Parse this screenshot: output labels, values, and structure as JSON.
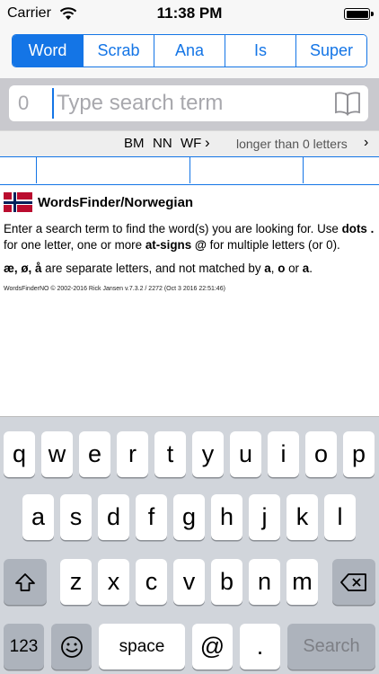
{
  "status_bar": {
    "carrier": "Carrier",
    "time": "11:38 PM"
  },
  "segments": [
    {
      "label": "Word",
      "active": true
    },
    {
      "label": "Scrab",
      "active": false
    },
    {
      "label": "Ana",
      "active": false
    },
    {
      "label": "Is",
      "active": false
    },
    {
      "label": "Super",
      "active": false
    }
  ],
  "search": {
    "count": "0",
    "placeholder": "Type search term",
    "value": "",
    "icon": "book-icon"
  },
  "options": {
    "dict_bm": "BM",
    "dict_nn": "NN",
    "dict_wf": "WF",
    "length_text": "longer than 0 letters",
    "chevron": "›"
  },
  "content": {
    "title": "WordsFinder/Norwegian",
    "intro_1": "Enter a search term to find the word(s) you are looking for. Use ",
    "dots_word": "dots .",
    "intro_2": " for one letter, one or more ",
    "at_word": "at-signs @",
    "intro_3": " for multiple letters (or 0).",
    "letters": "æ, ø, å",
    "letters_rest": " are separate letters, and not matched by ",
    "letter_a": "a",
    "comma": ", ",
    "letter_o": "o",
    "or_word": " or ",
    "letter_a2": "a",
    "period": ".",
    "credits": "WordsFinderNO © 2002-2016 Rick Jansen v.7.3.2 / 2272 (Oct 3 2016 22:51:46)"
  },
  "keyboard": {
    "row1": [
      "q",
      "w",
      "e",
      "r",
      "t",
      "y",
      "u",
      "i",
      "o",
      "p"
    ],
    "row2": [
      "a",
      "s",
      "d",
      "f",
      "g",
      "h",
      "j",
      "k",
      "l"
    ],
    "row3": [
      "z",
      "x",
      "c",
      "v",
      "b",
      "n",
      "m"
    ],
    "shift_icon": "shift-icon",
    "delete_icon": "delete-icon",
    "numbers": "123",
    "emoji_icon": "emoji-icon",
    "space": "space",
    "at": "@",
    "dot": ".",
    "search": "Search"
  }
}
